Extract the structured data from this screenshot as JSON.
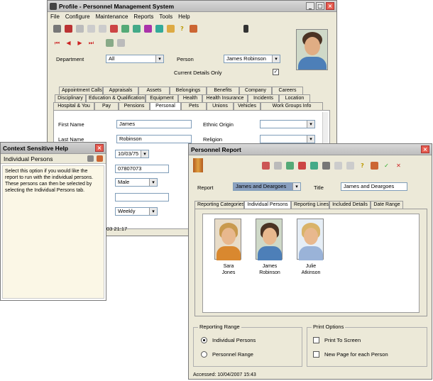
{
  "main": {
    "title": "Profile - Personnel Management System",
    "menu": [
      "File",
      "Configure",
      "Maintenance",
      "Reports",
      "Tools",
      "Help"
    ],
    "department_label": "Department",
    "department_value": "All",
    "person_label": "Person",
    "person_value": "James Robinson",
    "current_details_label": "Current Details Only",
    "current_details_checked": "✓",
    "tabs_row1": [
      "Appointment Calls",
      "Appraisals",
      "Assets",
      "Belongings",
      "Benefits",
      "Company",
      "Careers"
    ],
    "tabs_row2": [
      "Disciplinary",
      "Education & Qualifications",
      "Equipment",
      "Health",
      "Health Insurance",
      "Incidents",
      "Location"
    ],
    "tabs_row3": [
      "Hospital & You",
      "Pay",
      "Pensions",
      "Personal",
      "Pets",
      "Unions",
      "Vehicles",
      "Work Groups Info"
    ],
    "fields": {
      "first_name_label": "First Name",
      "first_name": "James",
      "last_name_label": "Last Name",
      "last_name": "Robinson",
      "dob": "10/03/75",
      "ni_number": "07807073",
      "gender": "Male",
      "blank": "",
      "frequency": "Weekly",
      "ethnic_origin_label": "Ethnic Origin",
      "religion_label": "Religion",
      "status": "03 21:17"
    }
  },
  "help": {
    "title": "Context Sensitive Help",
    "heading": "Individual Persons",
    "text": "Select this option if you would like the report to run with the individual persons. These persons can then be selected by selecting the Individual Persons tab."
  },
  "report": {
    "title": "Personnel Report",
    "report_label": "Report",
    "report_value": "James and Deargoes",
    "title_label": "Title",
    "title_value": "James and Deargoes",
    "tabs": [
      "Reporting Categories",
      "Individual Persons",
      "Reporting Lines",
      "Included Details",
      "Date Range"
    ],
    "persons": [
      {
        "first": "Sara",
        "last": "Jones"
      },
      {
        "first": "James",
        "last": "Robinson"
      },
      {
        "first": "Julie",
        "last": "Atkinson"
      }
    ],
    "range_group": "Reporting Range",
    "radio1": "Individual Persons",
    "radio2": "Personnel Range",
    "options_group": "Print Options",
    "opt1": "Print To Screen",
    "opt2": "New Page for each Person",
    "status": "Accessed: 10/04/2007 15:43"
  },
  "colors": {
    "hair_blonde": "#c99a4e",
    "hair_dark": "#4a3324",
    "hair_light": "#d9b36a",
    "shirt_orange": "#d9882f",
    "shirt_blue": "#4d7fb8",
    "shirt_lilac": "#9ab3d8"
  }
}
